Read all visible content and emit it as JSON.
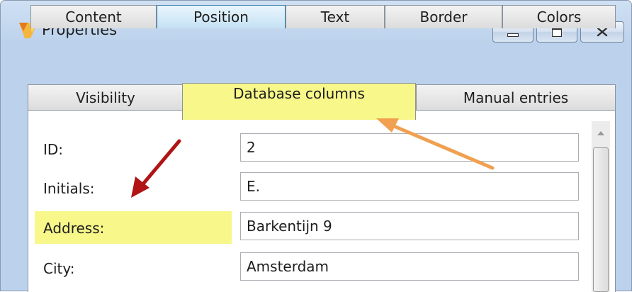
{
  "window": {
    "title": "Properties"
  },
  "tabs_row1": [
    "Content",
    "Position",
    "Text",
    "Border",
    "Colors"
  ],
  "tabs_row2_left": "Visibility",
  "tabs_row2_active": "Database columns",
  "tabs_row2_right": "Manual entries",
  "fields": [
    {
      "label": "ID:",
      "value": "2"
    },
    {
      "label": "Initials:",
      "value": "E."
    },
    {
      "label": "Address:",
      "value": "Barkentijn 9"
    },
    {
      "label": "City:",
      "value": "Amsterdam"
    }
  ],
  "colors": {
    "highlight": "#f7f78a",
    "orange_arrow": "#f0a050",
    "red_arrow": "#b01414"
  }
}
